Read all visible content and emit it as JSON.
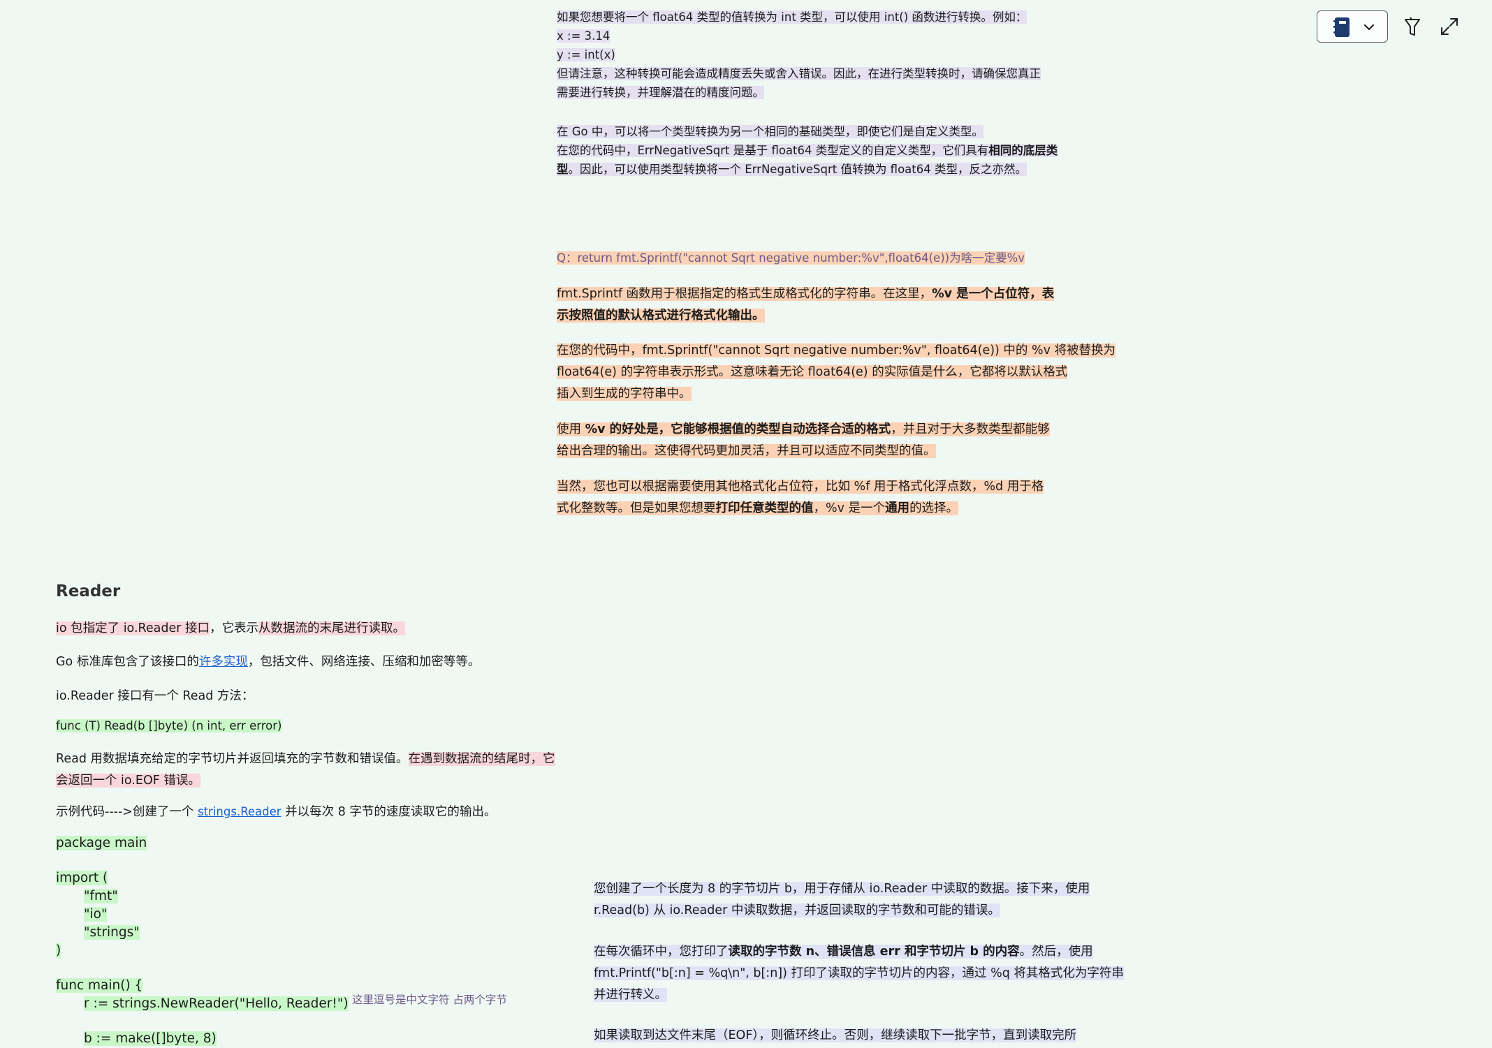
{
  "toolbar": {
    "notebook_icon": "notebook-icon",
    "dropdown_icon": "chevron-down-icon",
    "highlighter_icon": "highlighter-icon",
    "expand_icon": "expand-icon"
  },
  "top_block": {
    "l1": "如果您想要将一个 float64 类型的值转换为 int 类型，可以使用 int() 函数进行转换。例如：",
    "l2": "x := 3.14",
    "l3": "y := int(x)",
    "l4": "但请注意，这种转换可能会造成精度丢失或舍入错误。因此，在进行类型转换时，请确保您真正",
    "l5": "需要进行转换，并理解潜在的精度问题。",
    "l6": "在 Go 中，可以将一个类型转换为另一个相同的基础类型，即使它们是自定义类型。",
    "l7a": "在您的代码中，ErrNegativeSqrt 是基于 float64 类型定义的自定义类型，它们具有",
    "l7b": "相同的底层类",
    "l8a": "型",
    "l8b": "。因此，可以使用类型转换将一个 ErrNegativeSqrt 值转换为 float64 类型，反之亦然。"
  },
  "qa": {
    "question": "Q：return fmt.Sprintf(\"cannot Sqrt negative number:%v\",float64(e))为啥一定要%v",
    "p1a": "fmt.Sprintf 函数用于根据指定的格式生成格式化的字符串。在这里，",
    "p1b": "%v 是一个占位符，表",
    "p1c": "示按照值的默认格式进行格式化输出。",
    "p2a": "在您的代码中，fmt.Sprintf(\"cannot Sqrt negative number:%v\", float64(e)) 中的 %v 将被替换为",
    "p2b": "float64(e) 的字符串表示形式。这意味着无论 float64(e) 的实际值是什么，它都将以默认格式",
    "p2c": "插入到生成的字符串中。",
    "p3a": "使用 ",
    "p3b": "%v 的好处是，它能够根据值的类型自动选择合适的格式",
    "p3c": "，并且对于大多数类型都能够",
    "p3d": "给出合理的输出。这使得代码更加灵活，并且可以适应不同类型的值。",
    "p4a": "当然，您也可以根据需要使用其他格式化占位符，比如 %f 用于格式化浮点数，%d 用于格",
    "p4b": "式化整数等。但是如果您想要",
    "p4c": "打印任意类型的值",
    "p4d": "，%v 是一个",
    "p4e": "通用",
    "p4f": "的选择。"
  },
  "reader": {
    "heading": "Reader",
    "p1a": "io 包指定了 io.Reader 接口",
    "p1b": "，它表示",
    "p1c": "从数据流的末尾进行读取。",
    "p2a": "Go 标准库包含了该接口的",
    "p2link": "许多实现",
    "p2b": "，包括文件、网络连接、压缩和加密等等。",
    "p3": "io.Reader 接口有一个 Read 方法：",
    "sig": "func (T) Read(b []byte) (n int, err error)",
    "p4a": "Read 用数据填充给定的字节切片并返回填充的字节数和错误值。",
    "p4b": "在遇到数据流的结尾时，它",
    "p4c": "会返回一个 io.EOF 错误。",
    "p5a": "示例代码---->创建了一个 ",
    "p5link": "strings.Reader",
    "p5b": " 并以每次 8 字节的速度读取它的输出。"
  },
  "code": {
    "c1": "package main",
    "c2": "import (",
    "c3": "\"fmt\"",
    "c4": "\"io\"",
    "c5": "\"strings\"",
    "c6": ")",
    "c7": "func main() {",
    "c8": "r := strings.NewReader(\"Hello, Reader!\")",
    "c9": "b := make([]byte, 8)",
    "note": "这里逗号是中文字符 占两个字节"
  },
  "explain": {
    "e1": "您创建了一个长度为 8 的字节切片 b，用于存储从 io.Reader 中读取的数据。接下来，使用",
    "e2": "r.Read(b) 从 io.Reader 中读取数据，并返回读取的字节数和可能的错误。",
    "e3a": "在每次循环中，您打印了",
    "e3b": "读取的字节数 n、错误信息 err 和字节切片 b 的内容",
    "e3c": "。然后，使用",
    "e4": "fmt.Printf(\"b[:n] = %q\\n\", b[:n]) 打印了读取的字节切片的内容，通过 %q 将其格式化为字符串",
    "e5": "并进行转义。",
    "e6": "如果读取到达文件末尾（EOF），则循环终止。否则，继续读取下一批字节，直到读取完所"
  }
}
